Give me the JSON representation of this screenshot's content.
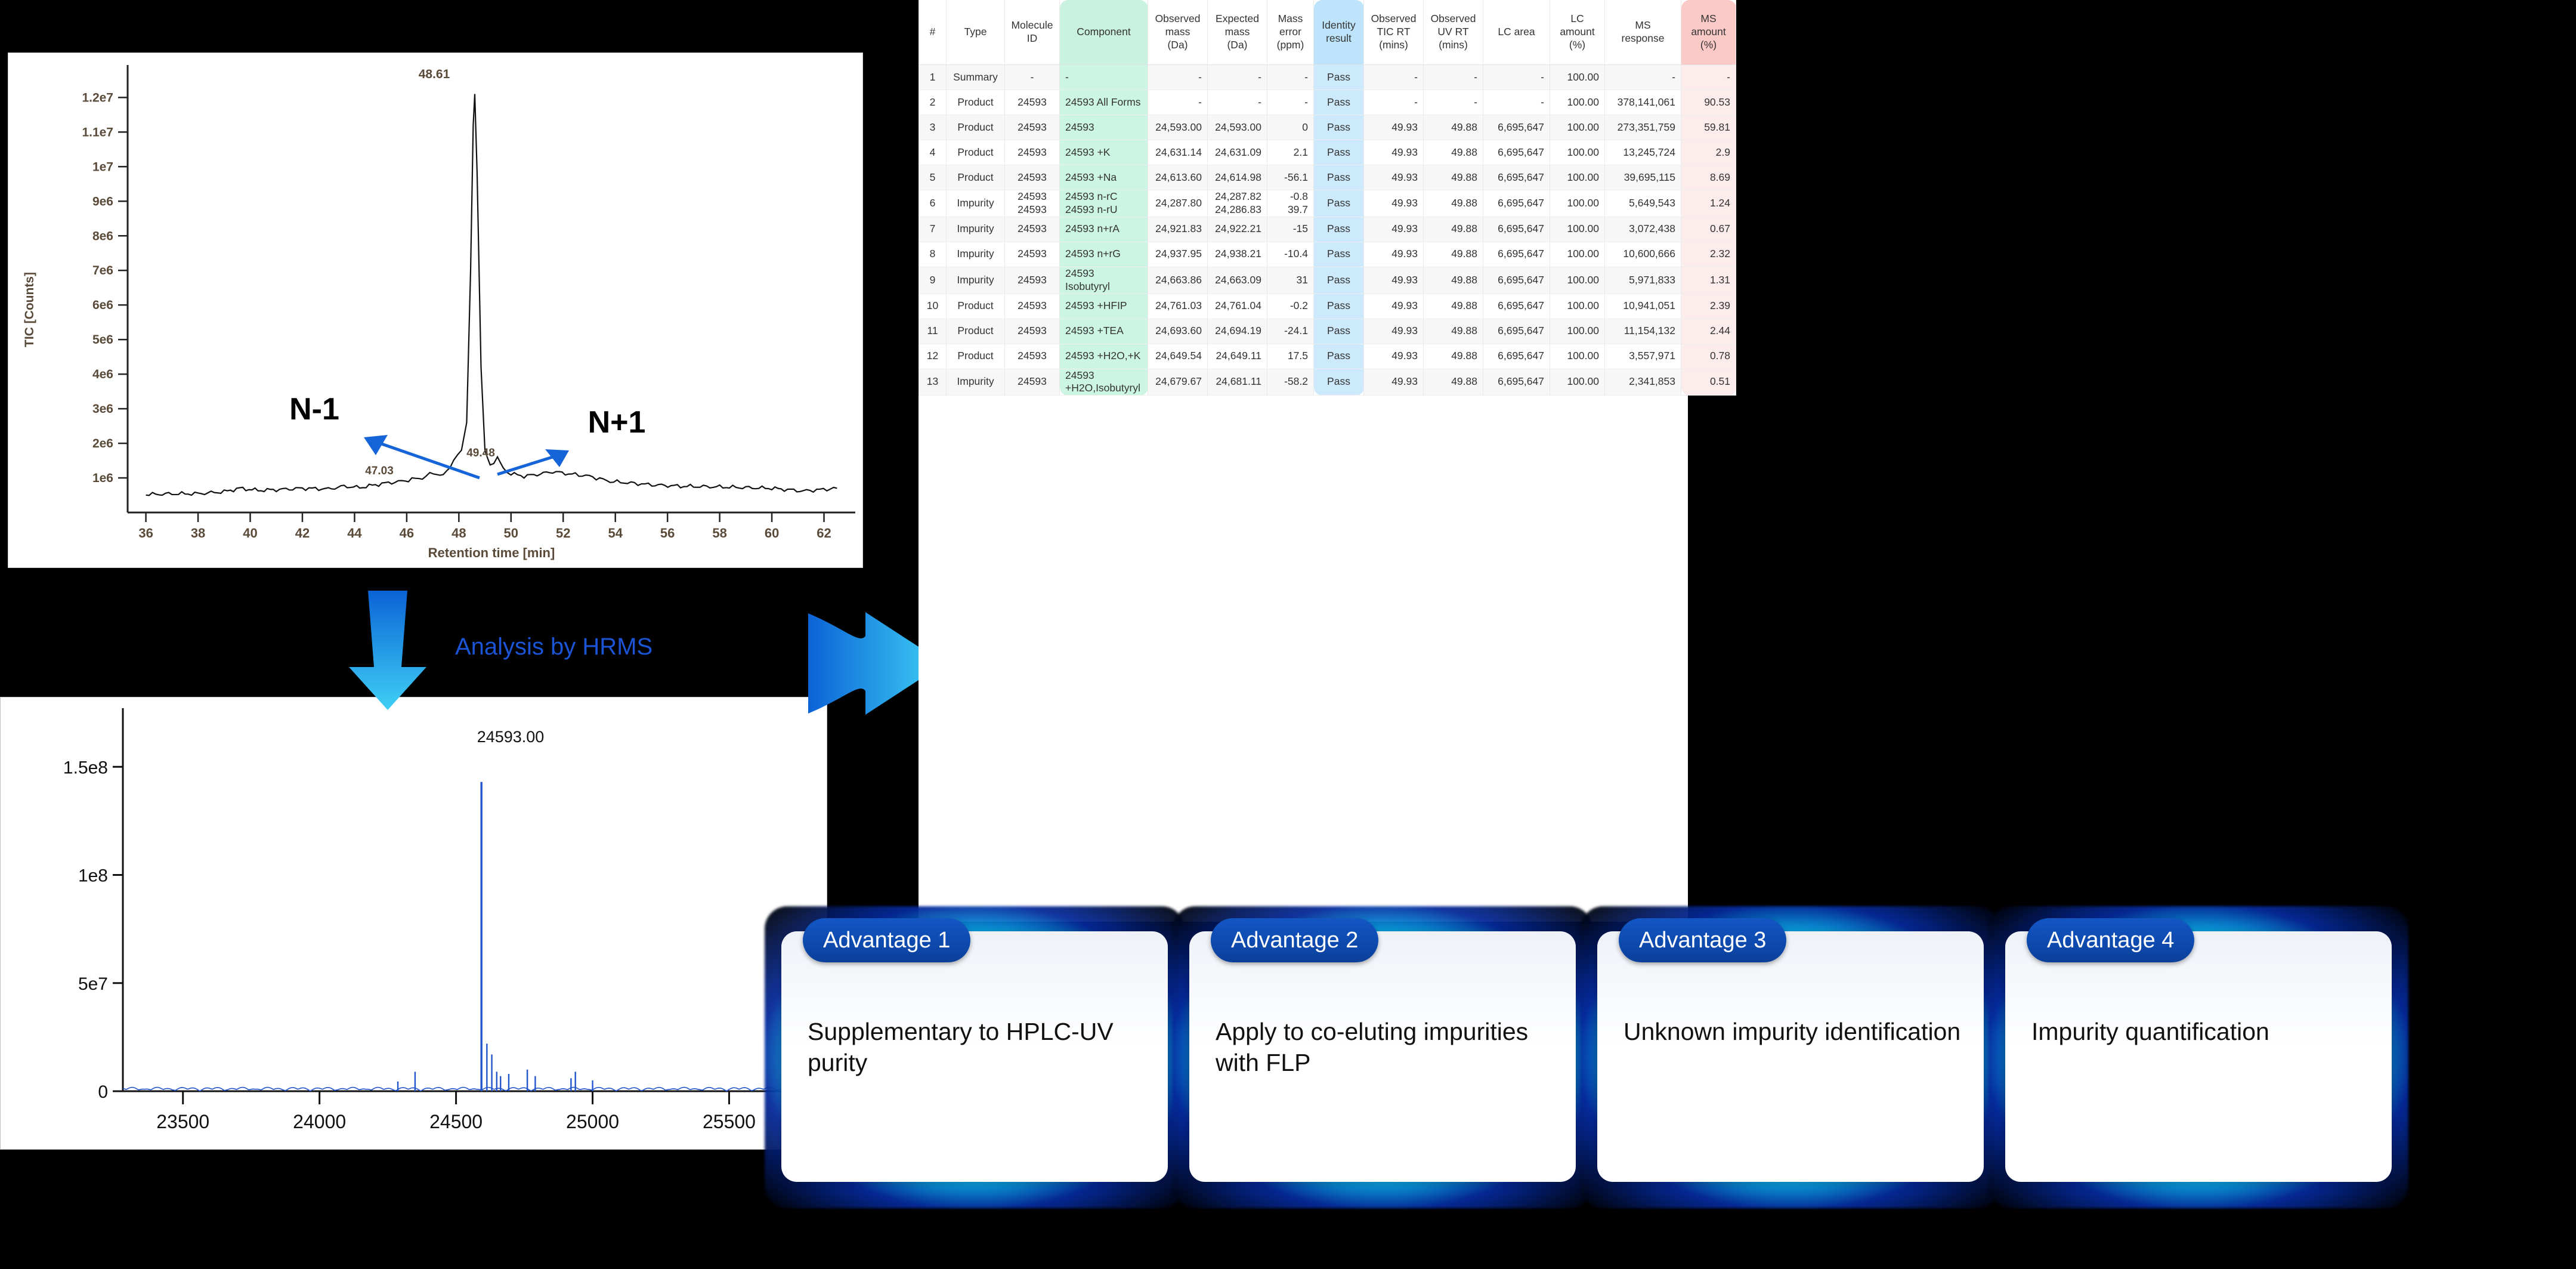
{
  "chromatogram": {
    "ylabel": "TIC [Counts]",
    "xlabel": "Retention time [min]",
    "y_ticks": [
      "1.2e7",
      "1.1e7",
      "1e7",
      "9e6",
      "8e6",
      "7e6",
      "6e6",
      "5e6",
      "4e6",
      "3e6",
      "2e6",
      "1e6"
    ],
    "x_ticks": [
      "36",
      "38",
      "40",
      "42",
      "44",
      "46",
      "48",
      "50",
      "52",
      "54",
      "56",
      "58",
      "60",
      "62"
    ],
    "peak_labels": [
      "48.61",
      "47.03",
      "49.48"
    ],
    "annotations": [
      "N-1",
      "N+1"
    ]
  },
  "massspec": {
    "y_ticks": [
      "1.5e8",
      "1e8",
      "5e7",
      "0"
    ],
    "x_ticks": [
      "23500",
      "24000",
      "24500",
      "25000",
      "25500"
    ],
    "peak_label": "24593.00"
  },
  "flow": {
    "caption": "Analysis by HRMS",
    "down_arrow": "down-arrow-icon",
    "right_arrow": "right-arrow-icon"
  },
  "chart_data": [
    {
      "type": "line",
      "title": "",
      "xlabel": "Retention time [min]",
      "ylabel": "TIC [Counts]",
      "xlim": [
        35.3,
        63.2
      ],
      "ylim": [
        0,
        12800000
      ],
      "grid": false,
      "annotations": [
        {
          "label": "48.61",
          "x": 48.61,
          "y": 12100000
        },
        {
          "label": "47.03",
          "x": 47.03,
          "y": 950000
        },
        {
          "label": "49.48",
          "x": 49.48,
          "y": 1400000
        },
        {
          "label": "N-1",
          "x": 45.6,
          "y": 3700000
        },
        {
          "label": "N+1",
          "x": 52.6,
          "y": 3500000
        }
      ],
      "series": [
        {
          "name": "TIC",
          "x": [
            36,
            37,
            38,
            39,
            39.6,
            40.3,
            41,
            42,
            43,
            43.6,
            44.2,
            44.8,
            45.3,
            45.8,
            46.2,
            46.6,
            47.03,
            47.4,
            47.8,
            48.1,
            48.3,
            48.45,
            48.55,
            48.61,
            48.7,
            48.85,
            49.0,
            49.2,
            49.48,
            49.7,
            50.0,
            50.5,
            51.0,
            51.6,
            52.2,
            53.0,
            53.8,
            54.6,
            55.4,
            56.5,
            58.0,
            60.0,
            61.2,
            62.5
          ],
          "y": [
            520000,
            540000,
            545000,
            600000,
            700000,
            640000,
            660000,
            700000,
            680000,
            760000,
            720000,
            800000,
            860000,
            900000,
            960000,
            1000000,
            1150000,
            1050000,
            1500000,
            1800000,
            2600000,
            7000000,
            11200000,
            12100000,
            9800000,
            4200000,
            1800000,
            1350000,
            1600000,
            1250000,
            1120000,
            1050000,
            1100000,
            1180000,
            1120000,
            1050000,
            900000,
            850000,
            800000,
            760000,
            740000,
            700000,
            620000,
            700000
          ]
        }
      ]
    },
    {
      "type": "line",
      "title": "",
      "xlabel": "",
      "ylabel": "",
      "xlim": [
        23280,
        25820
      ],
      "ylim": [
        0,
        160000000
      ],
      "grid": false,
      "annotations": [
        {
          "label": "24593.00",
          "x": 24593,
          "y": 143000000
        }
      ],
      "series": [
        {
          "name": "Deconvoluted mass spectrum",
          "peaks": [
            {
              "mass": 24287,
              "intensity": 4500000
            },
            {
              "mass": 24350,
              "intensity": 9000000
            },
            {
              "mass": 24593,
              "intensity": 143000000
            },
            {
              "mass": 24613,
              "intensity": 22000000
            },
            {
              "mass": 24631,
              "intensity": 17000000
            },
            {
              "mass": 24649,
              "intensity": 9000000
            },
            {
              "mass": 24663,
              "intensity": 7000000
            },
            {
              "mass": 24693,
              "intensity": 8000000
            },
            {
              "mass": 24761,
              "intensity": 10000000
            },
            {
              "mass": 24790,
              "intensity": 7000000
            },
            {
              "mass": 24921,
              "intensity": 6000000
            },
            {
              "mass": 24937,
              "intensity": 9000000
            },
            {
              "mass": 25000,
              "intensity": 5000000
            }
          ]
        }
      ]
    }
  ],
  "table": {
    "columns": [
      {
        "key": "num",
        "label": "#",
        "align": "ctr",
        "tint": "none",
        "width": 46
      },
      {
        "key": "type",
        "label": "Type",
        "align": "ctr",
        "tint": "none",
        "width": 98
      },
      {
        "key": "molecule_id",
        "label": "Molecule\nID",
        "align": "ctr",
        "tint": "none",
        "width": 92
      },
      {
        "key": "component",
        "label": "Component",
        "align": "lft",
        "tint": "green",
        "width": 148
      },
      {
        "key": "observed_mass",
        "label": "Observed\nmass\n(Da)",
        "align": "num",
        "tint": "none",
        "width": 100
      },
      {
        "key": "expected_mass",
        "label": "Expected\nmass\n(Da)",
        "align": "num",
        "tint": "none",
        "width": 100
      },
      {
        "key": "mass_error",
        "label": "Mass\nerror\n(ppm)",
        "align": "num",
        "tint": "none",
        "width": 78
      },
      {
        "key": "identity_result",
        "label": "Identity\nresult",
        "align": "ctr",
        "tint": "blue",
        "width": 84
      },
      {
        "key": "observed_tic_rt",
        "label": "Observed\nTIC RT\n(mins)",
        "align": "num",
        "tint": "none",
        "width": 100
      },
      {
        "key": "observed_uv_rt",
        "label": "Observed\nUV RT\n(mins)",
        "align": "num",
        "tint": "none",
        "width": 100
      },
      {
        "key": "lc_area",
        "label": "LC area",
        "align": "num",
        "tint": "none",
        "width": 112
      },
      {
        "key": "lc_amount",
        "label": "LC\namount\n(%)",
        "align": "num",
        "tint": "none",
        "width": 92
      },
      {
        "key": "ms_response",
        "label": "MS\nresponse",
        "align": "num",
        "tint": "none",
        "width": 128
      },
      {
        "key": "ms_amount",
        "label": "MS\namount\n(%)",
        "align": "num",
        "tint": "red",
        "width": 92
      }
    ],
    "rows": [
      {
        "num": "1",
        "type": "Summary",
        "molecule_id": "-",
        "component": "-",
        "observed_mass": "-",
        "expected_mass": "-",
        "mass_error": "-",
        "identity_result": "Pass",
        "observed_tic_rt": "-",
        "observed_uv_rt": "-",
        "lc_area": "-",
        "lc_amount": "100.00",
        "ms_response": "-",
        "ms_amount": "-"
      },
      {
        "num": "2",
        "type": "Product",
        "molecule_id": "24593",
        "component": "24593 All Forms",
        "observed_mass": "-",
        "expected_mass": "-",
        "mass_error": "-",
        "identity_result": "Pass",
        "observed_tic_rt": "-",
        "observed_uv_rt": "-",
        "lc_area": "-",
        "lc_amount": "100.00",
        "ms_response": "378,141,061",
        "ms_amount": "90.53"
      },
      {
        "num": "3",
        "type": "Product",
        "molecule_id": "24593",
        "component": "24593",
        "observed_mass": "24,593.00",
        "expected_mass": "24,593.00",
        "mass_error": "0",
        "identity_result": "Pass",
        "observed_tic_rt": "49.93",
        "observed_uv_rt": "49.88",
        "lc_area": "6,695,647",
        "lc_amount": "100.00",
        "ms_response": "273,351,759",
        "ms_amount": "59.81"
      },
      {
        "num": "4",
        "type": "Product",
        "molecule_id": "24593",
        "component": "24593 +K",
        "observed_mass": "24,631.14",
        "expected_mass": "24,631.09",
        "mass_error": "2.1",
        "identity_result": "Pass",
        "observed_tic_rt": "49.93",
        "observed_uv_rt": "49.88",
        "lc_area": "6,695,647",
        "lc_amount": "100.00",
        "ms_response": "13,245,724",
        "ms_amount": "2.9"
      },
      {
        "num": "5",
        "type": "Product",
        "molecule_id": "24593",
        "component": "24593 +Na",
        "observed_mass": "24,613.60",
        "expected_mass": "24,614.98",
        "mass_error": "-56.1",
        "identity_result": "Pass",
        "observed_tic_rt": "49.93",
        "observed_uv_rt": "49.88",
        "lc_area": "6,695,647",
        "lc_amount": "100.00",
        "ms_response": "39,695,115",
        "ms_amount": "8.69"
      },
      {
        "num": "6",
        "type": "Impurity",
        "molecule_id": "24593\n24593",
        "component": "24593 n-rC\n24593 n-rU",
        "observed_mass": "24,287.80",
        "expected_mass": "24,287.82\n24,286.83",
        "mass_error": "-0.8\n39.7",
        "identity_result": "Pass",
        "observed_tic_rt": "49.93",
        "observed_uv_rt": "49.88",
        "lc_area": "6,695,647",
        "lc_amount": "100.00",
        "ms_response": "5,649,543",
        "ms_amount": "1.24"
      },
      {
        "num": "7",
        "type": "Impurity",
        "molecule_id": "24593",
        "component": "24593 n+rA",
        "observed_mass": "24,921.83",
        "expected_mass": "24,922.21",
        "mass_error": "-15",
        "identity_result": "Pass",
        "observed_tic_rt": "49.93",
        "observed_uv_rt": "49.88",
        "lc_area": "6,695,647",
        "lc_amount": "100.00",
        "ms_response": "3,072,438",
        "ms_amount": "0.67"
      },
      {
        "num": "8",
        "type": "Impurity",
        "molecule_id": "24593",
        "component": "24593 n+rG",
        "observed_mass": "24,937.95",
        "expected_mass": "24,938.21",
        "mass_error": "-10.4",
        "identity_result": "Pass",
        "observed_tic_rt": "49.93",
        "observed_uv_rt": "49.88",
        "lc_area": "6,695,647",
        "lc_amount": "100.00",
        "ms_response": "10,600,666",
        "ms_amount": "2.32"
      },
      {
        "num": "9",
        "type": "Impurity",
        "molecule_id": "24593",
        "component": "24593\nIsobutyryl",
        "observed_mass": "24,663.86",
        "expected_mass": "24,663.09",
        "mass_error": "31",
        "identity_result": "Pass",
        "observed_tic_rt": "49.93",
        "observed_uv_rt": "49.88",
        "lc_area": "6,695,647",
        "lc_amount": "100.00",
        "ms_response": "5,971,833",
        "ms_amount": "1.31"
      },
      {
        "num": "10",
        "type": "Product",
        "molecule_id": "24593",
        "component": "24593 +HFIP",
        "observed_mass": "24,761.03",
        "expected_mass": "24,761.04",
        "mass_error": "-0.2",
        "identity_result": "Pass",
        "observed_tic_rt": "49.93",
        "observed_uv_rt": "49.88",
        "lc_area": "6,695,647",
        "lc_amount": "100.00",
        "ms_response": "10,941,051",
        "ms_amount": "2.39"
      },
      {
        "num": "11",
        "type": "Product",
        "molecule_id": "24593",
        "component": "24593 +TEA",
        "observed_mass": "24,693.60",
        "expected_mass": "24,694.19",
        "mass_error": "-24.1",
        "identity_result": "Pass",
        "observed_tic_rt": "49.93",
        "observed_uv_rt": "49.88",
        "lc_area": "6,695,647",
        "lc_amount": "100.00",
        "ms_response": "11,154,132",
        "ms_amount": "2.44"
      },
      {
        "num": "12",
        "type": "Product",
        "molecule_id": "24593",
        "component": "24593 +H2O,+K",
        "observed_mass": "24,649.54",
        "expected_mass": "24,649.11",
        "mass_error": "17.5",
        "identity_result": "Pass",
        "observed_tic_rt": "49.93",
        "observed_uv_rt": "49.88",
        "lc_area": "6,695,647",
        "lc_amount": "100.00",
        "ms_response": "3,557,971",
        "ms_amount": "0.78"
      },
      {
        "num": "13",
        "type": "Impurity",
        "molecule_id": "24593",
        "component": "24593\n+H2O,Isobutyryl",
        "observed_mass": "24,679.67",
        "expected_mass": "24,681.11",
        "mass_error": "-58.2",
        "identity_result": "Pass",
        "observed_tic_rt": "49.93",
        "observed_uv_rt": "49.88",
        "lc_area": "6,695,647",
        "lc_amount": "100.00",
        "ms_response": "2,341,853",
        "ms_amount": "0.51"
      }
    ]
  },
  "advantages": [
    {
      "tab": "Advantage 1",
      "body": "Supplementary to HPLC-UV purity"
    },
    {
      "tab": "Advantage 2",
      "body": "Apply to co-eluting impurities with FLP"
    },
    {
      "tab": "Advantage 3",
      "body": "Unknown impurity identification"
    },
    {
      "tab": "Advantage 4",
      "body": "Impurity quantification"
    }
  ],
  "colors": {
    "component_tint": "#ccf5e4",
    "identity_tint": "#cdeafd",
    "ms_amount_tint": "#fceceb",
    "advantage_tab": "#0d49ad",
    "arrow_blue": "#1b8ce8",
    "annotation_blue": "#1b55d6"
  }
}
